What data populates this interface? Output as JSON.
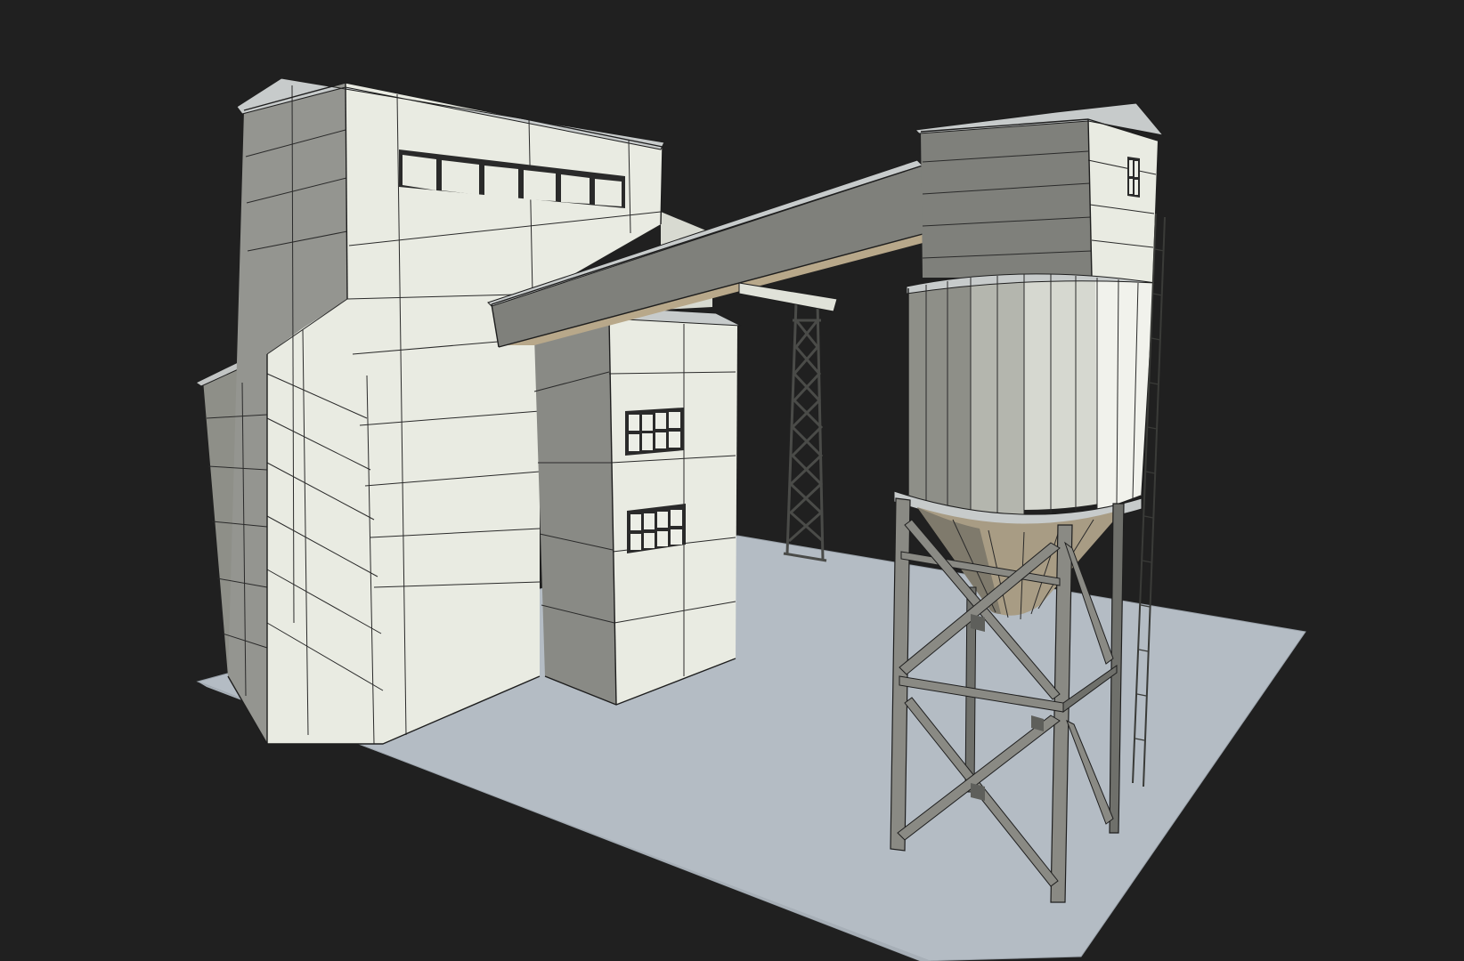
{
  "scene": {
    "background": "#202020",
    "ground": "#b4bcc4",
    "wall_light": "#e9ebe2",
    "wall_shade": "#8e8f88",
    "wall_dark": "#7a7b76",
    "steel": "#8a8a84",
    "steel_dark": "#5e5f5b",
    "roof": "#c7cbcb",
    "underside": "#b8a88a"
  }
}
